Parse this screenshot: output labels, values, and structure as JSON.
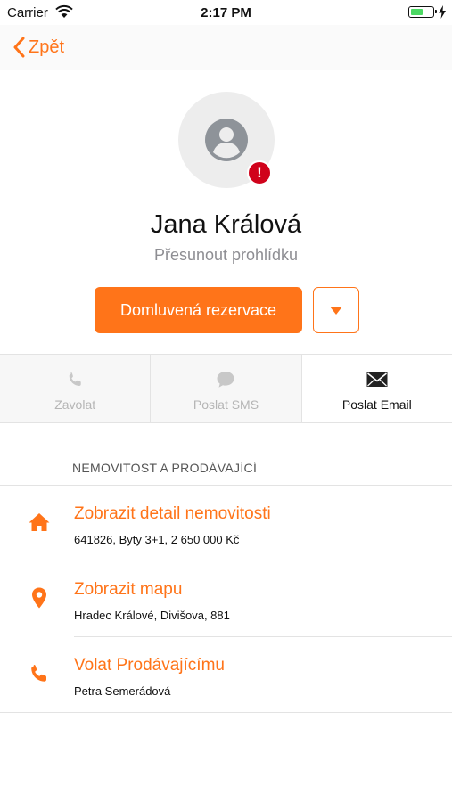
{
  "status_bar": {
    "carrier": "Carrier",
    "time": "2:17 PM",
    "battery_level": 0.6
  },
  "nav": {
    "back_label": "Zpět"
  },
  "profile": {
    "name": "Jana Králová",
    "subtitle": "Přesunout prohlídku",
    "alert_badge": "!"
  },
  "primary_action": {
    "label": "Domluvená rezervace"
  },
  "actions": [
    {
      "label": "Zavolat",
      "icon": "phone-icon",
      "enabled": false
    },
    {
      "label": "Poslat SMS",
      "icon": "chat-bubble-icon",
      "enabled": false
    },
    {
      "label": "Poslat Email",
      "icon": "envelope-icon",
      "enabled": true
    }
  ],
  "section": {
    "title": "NEMOVITOST A PRODÁVAJÍCÍ",
    "rows": [
      {
        "title": "Zobrazit detail nemovitosti",
        "subtitle": "641826, Byty 3+1, 2 650 000 Kč",
        "icon": "house-icon"
      },
      {
        "title": "Zobrazit mapu",
        "subtitle": "Hradec Králové, Divišova, 881",
        "icon": "map-pin-icon"
      },
      {
        "title": "Volat Prodávajícímu",
        "subtitle": "Petra Semerádová",
        "icon": "phone-icon"
      }
    ]
  },
  "colors": {
    "accent": "#ff7419",
    "alert": "#d0021b",
    "disabled": "#b5b5b5",
    "battery": "#4cd964"
  }
}
